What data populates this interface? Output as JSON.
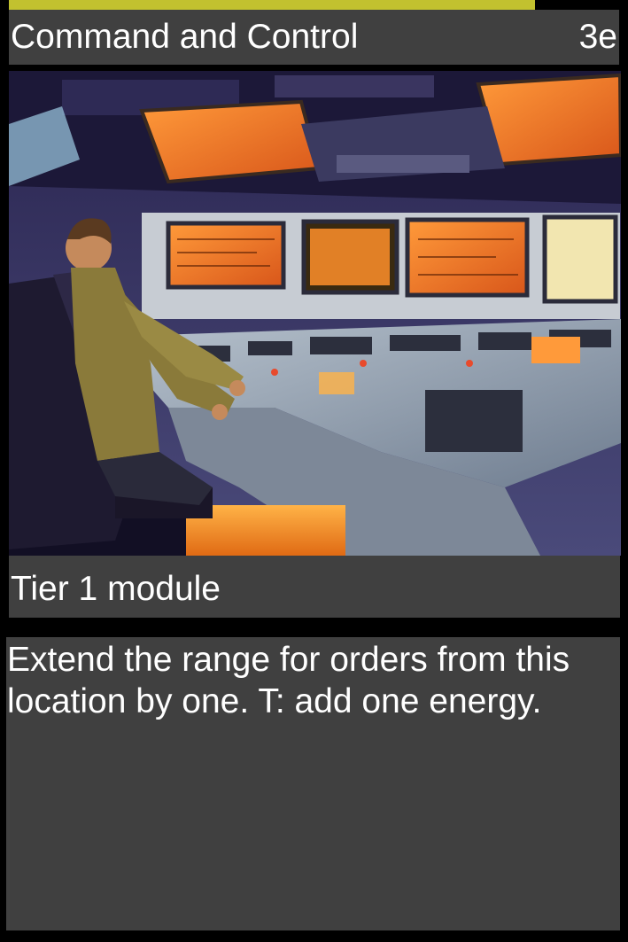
{
  "card": {
    "title": "Command and Control",
    "cost": "3e",
    "type_line": "Tier 1 module",
    "rules_text": "Extend the range for orders from this location by one. T: add one energy."
  },
  "colors": {
    "accent_bar": "#c2c12f",
    "panel": "#404040",
    "background": "#000000",
    "text": "#ffffff"
  },
  "art": {
    "subject": "operator seated at a control console with orange screens"
  }
}
